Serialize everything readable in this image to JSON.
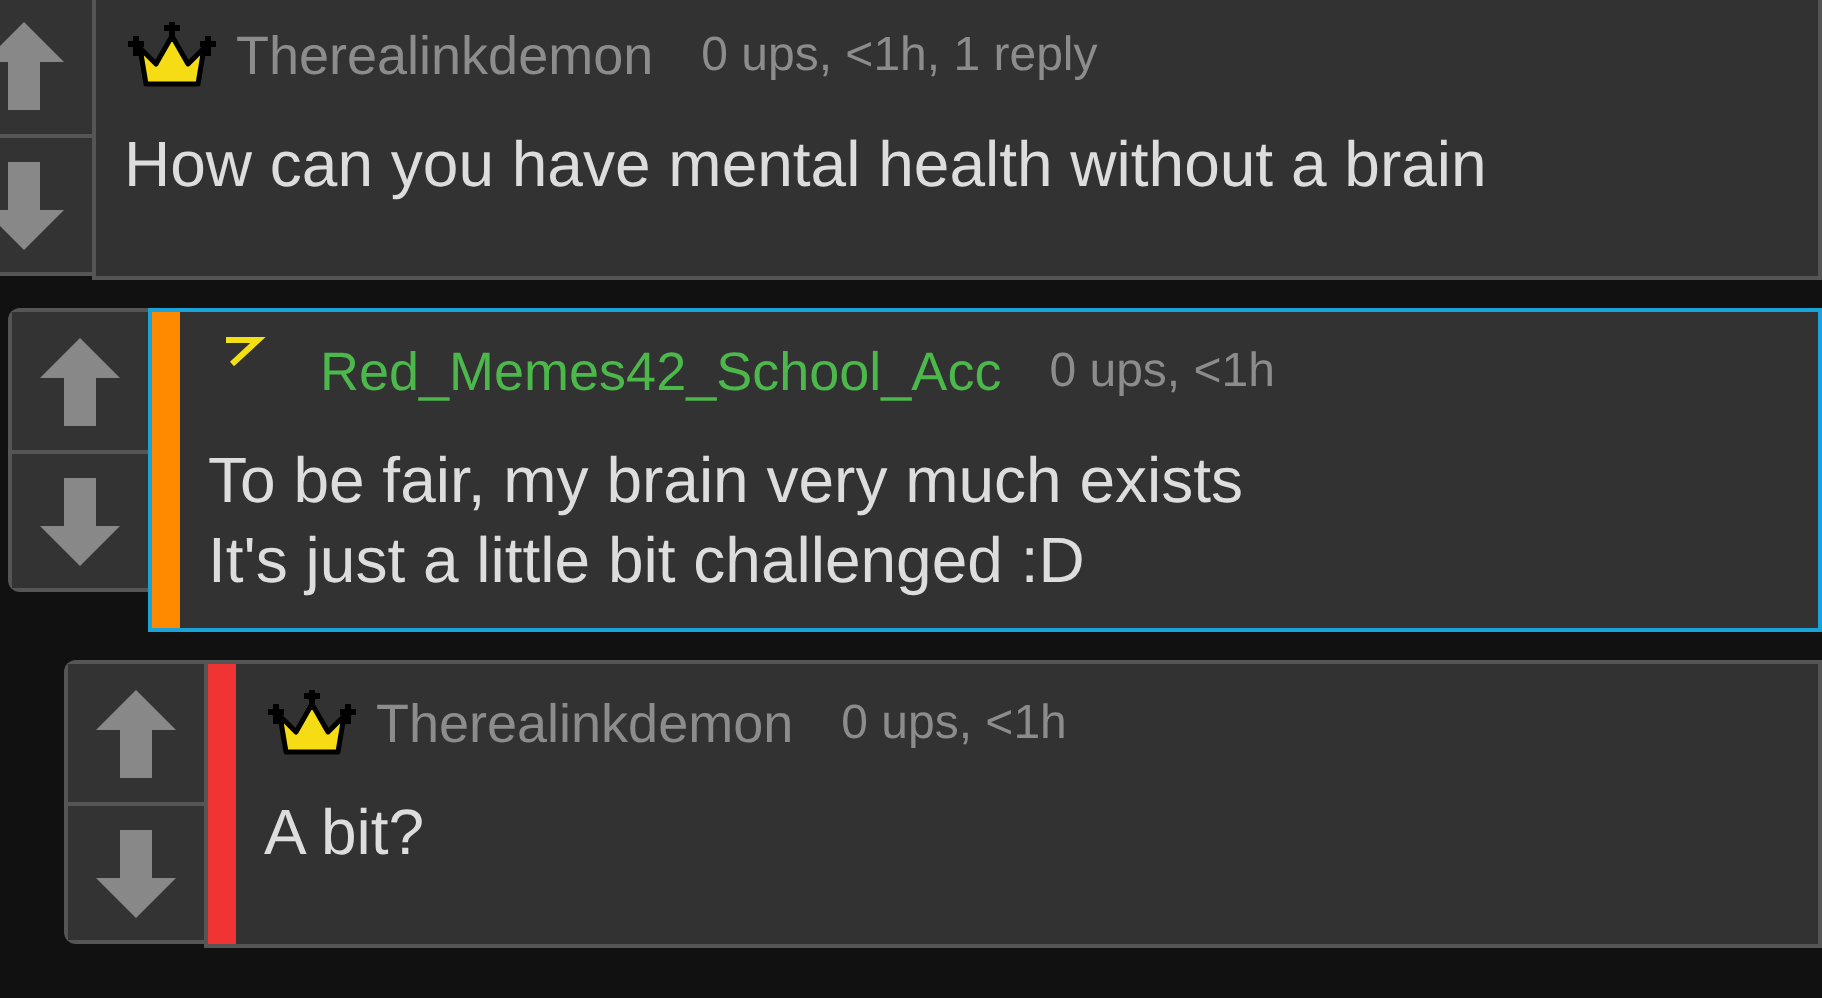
{
  "comments": [
    {
      "kind": "crown",
      "author": {
        "name": "Therealinkdemon",
        "color": "#8c8c8c"
      },
      "meta": "0 ups, <1h, 1 reply",
      "lines": [
        "How can you have mental health without a brain"
      ],
      "highlighted": false,
      "children": [
        {
          "kind": "bolt",
          "author": {
            "name": "Red_Memes42_School_Acc",
            "color": "#4cb84c"
          },
          "meta": "0 ups, <1h",
          "lines": [
            "To be fair, my brain very much exists",
            "It's just a little bit challenged :D"
          ],
          "highlighted": true,
          "accent_bar": {
            "color": "#ff8a00"
          },
          "children": [
            {
              "kind": "crown",
              "author": {
                "name": "Therealinkdemon",
                "color": "#8c8c8c"
              },
              "meta": "0 ups, <1h",
              "lines": [
                "A bit?"
              ],
              "highlighted": false,
              "accent_bar": {
                "color": "#f03434"
              }
            }
          ]
        }
      ]
    }
  ]
}
